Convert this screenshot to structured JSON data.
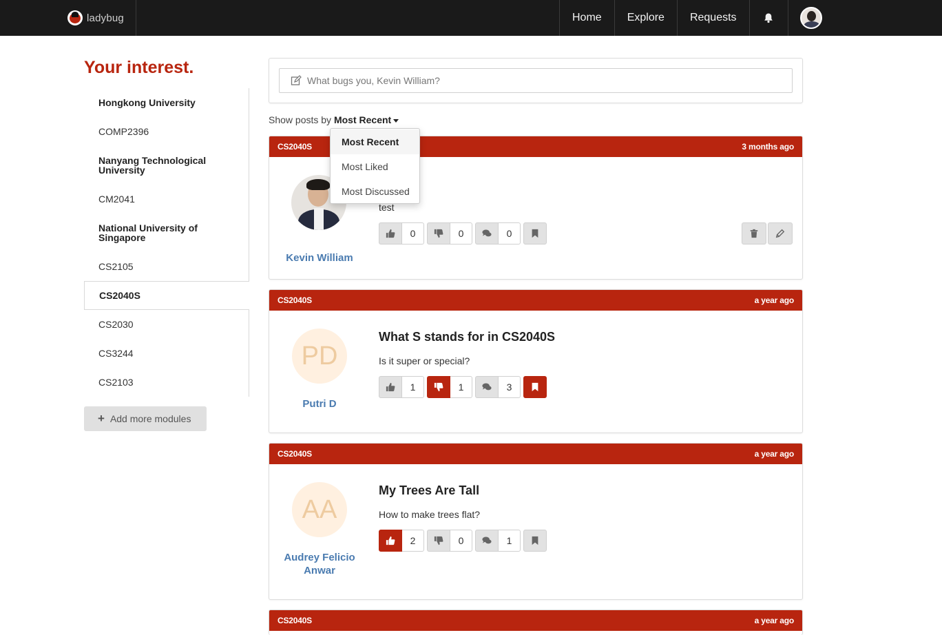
{
  "nav": {
    "brand": "ladybug",
    "items": [
      "Home",
      "Explore",
      "Requests"
    ]
  },
  "sidebar": {
    "title": "Your interest.",
    "items": [
      {
        "label": "Hongkong University",
        "bold": true
      },
      {
        "label": "COMP2396",
        "bold": false
      },
      {
        "label": "Nanyang Technological University",
        "bold": true
      },
      {
        "label": "CM2041",
        "bold": false
      },
      {
        "label": "National University of Singapore",
        "bold": true
      },
      {
        "label": "CS2105",
        "bold": false
      },
      {
        "label": "CS2040S",
        "bold": false,
        "active": true
      },
      {
        "label": "CS2030",
        "bold": false
      },
      {
        "label": "CS3244",
        "bold": false
      },
      {
        "label": "CS2103",
        "bold": false
      }
    ],
    "add_label": "Add more modules"
  },
  "composer": {
    "placeholder": "What bugs you, Kevin William?"
  },
  "sort": {
    "prefix": "Show posts by",
    "selected": "Most Recent",
    "options": [
      "Most Recent",
      "Most Liked",
      "Most Discussed"
    ]
  },
  "posts": [
    {
      "module": "CS2040S",
      "time": "3 months ago",
      "author": "Kevin William",
      "title": "",
      "text": "test",
      "likes": "0",
      "dislikes": "0",
      "comments": "0",
      "liked": false,
      "disliked": false,
      "bookmarked": false,
      "owner": true
    },
    {
      "module": "CS2040S",
      "time": "a year ago",
      "author": "Putri D",
      "initials": "PD",
      "title": "What S stands for in CS2040S",
      "text": "Is it super or special?",
      "likes": "1",
      "dislikes": "1",
      "comments": "3",
      "liked": false,
      "disliked": true,
      "bookmarked": true
    },
    {
      "module": "CS2040S",
      "time": "a year ago",
      "author": "Audrey Felicio Anwar",
      "initials": "AA",
      "title": "My Trees Are Tall",
      "text": "How to make trees flat?",
      "likes": "2",
      "dislikes": "0",
      "comments": "1",
      "liked": true,
      "disliked": false,
      "bookmarked": false
    },
    {
      "module": "CS2040S",
      "time": "a year ago"
    }
  ],
  "colors": {
    "accent": "#b8250f",
    "navbar": "#1a1a1a",
    "author_link": "#4a7bb0"
  }
}
